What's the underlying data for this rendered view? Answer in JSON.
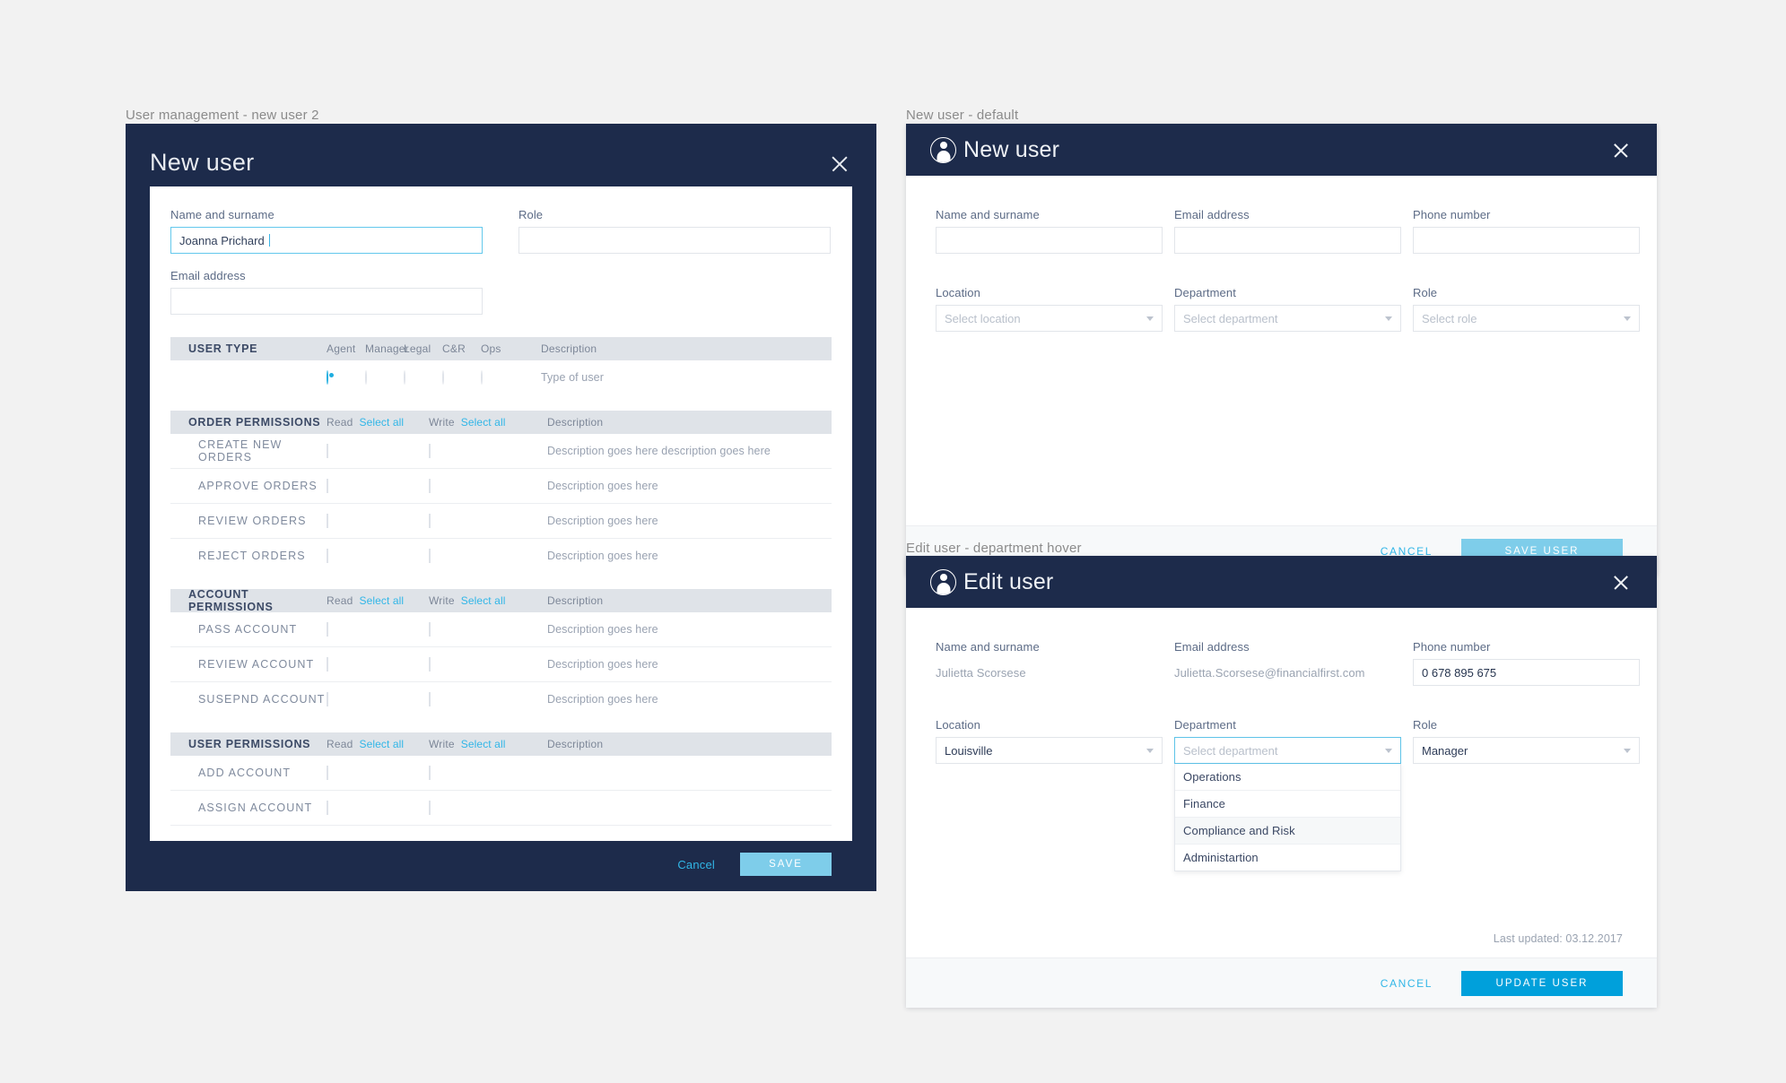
{
  "panel1": {
    "caption": "User management - new user 2",
    "title": "New user",
    "close_icon": "close-icon",
    "fields": {
      "name_label": "Name and surname",
      "name_value": "Joanna Prichard",
      "role_label": "Role",
      "role_value": "",
      "email_label": "Email address",
      "email_value": ""
    },
    "user_type": {
      "header": "USER TYPE",
      "columns": [
        "Agent",
        "Manager",
        "Legal",
        "C&R",
        "Ops"
      ],
      "desc_header": "Description",
      "row_desc": "Type of user",
      "selected_index": 0
    },
    "sections": [
      {
        "header": "ORDER PERMISSIONS",
        "read_label": "Read",
        "read_link": "Select all",
        "write_label": "Write",
        "write_link": "Select all",
        "desc_header": "Description",
        "rows": [
          {
            "name": "CREATE NEW ORDERS",
            "desc": "Description goes here description goes here"
          },
          {
            "name": "APPROVE ORDERS",
            "desc": "Description goes here"
          },
          {
            "name": "REVIEW ORDERS",
            "desc": "Description goes here"
          },
          {
            "name": "REJECT ORDERS",
            "desc": "Description goes here"
          }
        ]
      },
      {
        "header": "ACCOUNT PERMISSIONS",
        "read_label": "Read",
        "read_link": "Select all",
        "write_label": "Write",
        "write_link": "Select all",
        "desc_header": "Description",
        "rows": [
          {
            "name": "PASS ACCOUNT",
            "desc": "Description goes here"
          },
          {
            "name": "REVIEW ACCOUNT",
            "desc": "Description goes here"
          },
          {
            "name": "SUSEPND ACCOUNT",
            "desc": "Description goes here"
          }
        ]
      },
      {
        "header": "USER PERMISSIONS",
        "read_label": "Read",
        "read_link": "Select all",
        "write_label": "Write",
        "write_link": "Select all",
        "desc_header": "Description",
        "rows": [
          {
            "name": "ADD ACCOUNT",
            "desc": ""
          },
          {
            "name": "ASSIGN ACCOUNT",
            "desc": ""
          }
        ]
      }
    ],
    "actions": {
      "cancel": "Cancel",
      "save": "SAVE"
    }
  },
  "panel2": {
    "caption": "New user - default",
    "title": "New user",
    "avatar_icon": "user-avatar-icon",
    "close_icon": "close-icon",
    "fields": {
      "name_label": "Name and surname",
      "name_value": "",
      "email_label": "Email address",
      "email_value": "",
      "phone_label": "Phone number",
      "phone_value": "",
      "location_label": "Location",
      "location_placeholder": "Select location",
      "department_label": "Department",
      "department_placeholder": "Select department",
      "role_label": "Role",
      "role_placeholder": "Select role"
    },
    "footer": {
      "cancel": "CANCEL",
      "primary": "SAVE USER"
    }
  },
  "panel3": {
    "caption": "Edit user - department hover",
    "title": "Edit user",
    "avatar_icon": "user-avatar-icon",
    "close_icon": "close-icon",
    "fields": {
      "name_label": "Name and surname",
      "name_value": "Julietta Scorsese",
      "email_label": "Email address",
      "email_value": "Julietta.Scorsese@financialfirst.com",
      "phone_label": "Phone number",
      "phone_value": "0 678 895 675",
      "location_label": "Location",
      "location_value": "Louisville",
      "department_label": "Department",
      "department_placeholder": "Select department",
      "role_label": "Role",
      "role_value": "Manager"
    },
    "department_options": [
      {
        "label": "Operations",
        "hover": false
      },
      {
        "label": "Finance",
        "hover": false
      },
      {
        "label": "Compliance and Risk",
        "hover": true
      },
      {
        "label": "Administartion",
        "hover": false
      }
    ],
    "last_updated": "Last updated: 03.12.2017",
    "footer": {
      "cancel": "CANCEL",
      "primary": "UPDATE USER"
    }
  },
  "colors": {
    "navy": "#1d2b4b",
    "accent_light": "#7ecdea",
    "accent": "#00a0db",
    "link": "#31b6e7",
    "header_row": "#dfe3e8"
  }
}
